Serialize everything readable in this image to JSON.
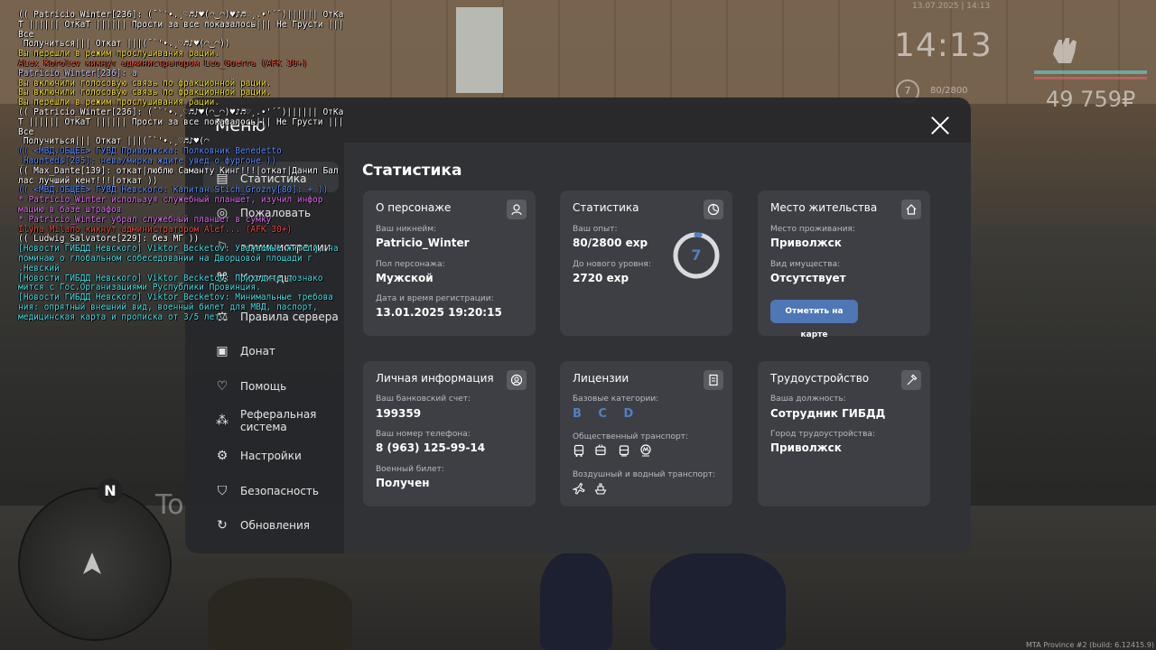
{
  "hud": {
    "clock": "14:13",
    "date": "13.07.2025 | 14:13",
    "level": "7",
    "exp": "80/2800",
    "money": "49 759₽",
    "build": "MTA Province #2 (build: 6.12415.9)"
  },
  "world": {
    "ghost_text": "To",
    "minimap_north": "N"
  },
  "menu": {
    "title": "Меню",
    "sidebar": [
      {
        "label": "Статистика",
        "icon": "chart-icon"
      },
      {
        "label": "Правила сервера",
        "icon": "scales-icon"
      },
      {
        "label": "Донат",
        "icon": "wallet-icon"
      },
      {
        "label": "Помощь",
        "icon": "heart-hand-icon"
      },
      {
        "label": "Реферальная\nсистема",
        "icon": "network-icon"
      },
      {
        "label": "Настройки",
        "icon": "gear-icon"
      },
      {
        "label": "Безопасность",
        "icon": "shield-icon"
      },
      {
        "label": "Обновления",
        "icon": "refresh-icon"
      }
    ],
    "sidebar_partial": [
      "Пожаловать",
      "администрации",
      "Команды"
    ]
  },
  "stats": {
    "title": "Статистика",
    "character": {
      "header": "О персонаже",
      "nick_label": "Ваш никнейм:",
      "nick": "Patricio_Winter",
      "sex_label": "Пол персонажа:",
      "sex": "Мужской",
      "reg_label": "Дата и время регистрации:",
      "reg": "13.01.2025 19:20:15"
    },
    "statistics": {
      "header": "Статистика",
      "exp_label": "Ваш опыт:",
      "exp": "80/2800 exp",
      "next_label": "До нового уровня:",
      "next": "2720 exp",
      "level": "7",
      "level_progress": 0.0286
    },
    "residence": {
      "header": "Место жительства",
      "place_label": "Место проживания:",
      "place": "Приволжск",
      "property_label": "Вид имущества:",
      "property": "Отсутствует",
      "map_button": "Отметить на карте"
    },
    "personal": {
      "header": "Личная информация",
      "bank_label": "Ваш банковский счет:",
      "bank": "199359",
      "phone_label": "Ваш номер телефона:",
      "phone": "8 (963) 125-99-14",
      "military_label": "Военный билет:",
      "military": "Получен"
    },
    "licenses": {
      "header": "Лицензии",
      "base_label": "Базовые категории:",
      "base": "B C D",
      "public_label": "Общественный транспорт:",
      "public_icons": [
        "bus-icon",
        "trolleybus-icon",
        "tram-icon",
        "metro-icon"
      ],
      "air_label": "Воздушный и водный транспорт:",
      "air_icons": [
        "plane-icon",
        "ship-icon"
      ]
    },
    "employment": {
      "header": "Трудоустройство",
      "job_label": "Ваша должность:",
      "job": "Сотрудник ГИБДД",
      "city_label": "Город трудоустройства:",
      "city": "Приволжск"
    }
  },
  "chat": [
    {
      "text": "(( Patricio_Winter[236]: (¯`'•.¸♡♬♪♥(◠‿◠)♥♪♬♡¸.•'´¯)|||||| ОтКа\nТ |||||| ОтКаТ |||||| Прости за все показалось||| Не Грусти ||| Все\n Получиться||| Откат |||(¯`'•.¸♡♬♪♥(◠‿◠))",
      "color": "#ffffff"
    },
    {
      "text": "Вы перешли в режим прослушивания рации.",
      "color": "#f2e033"
    },
    {
      "text": "ALex_Korolev кикнут администратором Leo_Guerra (AFK 30+)",
      "color": "#e84a3c"
    },
    {
      "text": "Patricio_Winter[236]: а",
      "color": "#c8c8ff"
    },
    {
      "text": "Вы включили голосовую связь по фракционной рации.",
      "color": "#f2e033"
    },
    {
      "text": "Вы включили голосовую связь по фракционной рации.",
      "color": "#f2e033"
    },
    {
      "text": "Вы перешли в режим прослушивания рации.",
      "color": "#f2e033"
    },
    {
      "text": "(( Patricio_Winter[236]: (¯`'•.¸♡♬♪♥(◠‿◠)♥♪♬♡¸.•'´¯)|||||| ОтКа\nТ |||||| ОтКаТ |||||| Прости за все показалось||| Не Грусти ||| Все\n Получиться||| Откат |||(¯`'•.¸♡♬♪♥(◠",
      "color": "#ffffff"
    },
    {
      "text": "(( <МВД.ОБЩЕЕ> ГУВД Приволжска: Полковник Benedetto\n_Haunteds[205]: нева/мирка ждите увед о фургоне ))",
      "color": "#5a8cff"
    },
    {
      "text": "(( Max_Dante[139]: откат|люблю Саманту Кинг!!!|откат|Данил Бал\nлас лучший кент!!!|откат ))",
      "color": "#ffffff"
    },
    {
      "text": "(( <МВД.ОБЩЕЕ> ГУВД Невского: Капитан Stich_Grozny[80]: + ))",
      "color": "#5a8cff"
    },
    {
      "text": "* Patricio_Winter используя служебный планшет, изучил инфор\nмацию в базе штрафов",
      "color": "#e06cf0"
    },
    {
      "text": "* Patricio_Winter убрал служебный планшет в сумку",
      "color": "#e06cf0"
    },
    {
      "text": "Ilyha_Milano кикнут администратором Alef... (AFK 30+)",
      "color": "#e84a3c"
    },
    {
      "text": "(( Ludwig_Salvatore[229]: без МГ ))",
      "color": "#ffffff"
    },
    {
      "text": "[Новости ГИБДД Невского] Viktor_Becketov: Уважаемые жители, на\nпоминаю о глобальном собеседовании на Дворцовой площади г\n.Невский",
      "color": "#45e0e6"
    },
    {
      "text": "[Новости ГИБДД Невского] Viktor_Becketov: Приходите познако\nмится с Гос.Организациями Руспублики Провинция.",
      "color": "#45e0e6"
    },
    {
      "text": "[Новости ГИБДД Невского] Viktor_Becketov: Минимальные требова\nния: опрятный внешний вид, военный билет для МВД, паспорт,\nмедицинская карта и прописка от 3/5 лет.",
      "color": "#45e0e6"
    }
  ]
}
